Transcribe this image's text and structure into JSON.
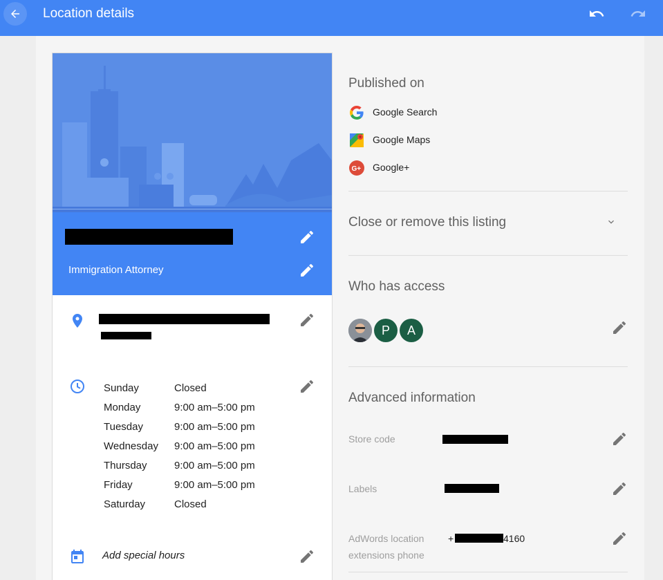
{
  "topbar": {
    "title": "Location details",
    "back_icon": "arrow-back-icon",
    "undo_icon": "undo-icon",
    "redo_icon": "redo-icon",
    "color": "#4285f4"
  },
  "business": {
    "category": "Immigration Attorney"
  },
  "hours": [
    {
      "day": "Sunday",
      "time": "Closed"
    },
    {
      "day": "Monday",
      "time": "9:00 am–5:00 pm"
    },
    {
      "day": "Tuesday",
      "time": "9:00 am–5:00 pm"
    },
    {
      "day": "Wednesday",
      "time": "9:00 am–5:00 pm"
    },
    {
      "day": "Thursday",
      "time": "9:00 am–5:00 pm"
    },
    {
      "day": "Friday",
      "time": "9:00 am–5:00 pm"
    },
    {
      "day": "Saturday",
      "time": "Closed"
    }
  ],
  "special_hours": "Add special hours",
  "published": {
    "title": "Published on",
    "items": [
      "Google Search",
      "Google Maps",
      "Google+"
    ]
  },
  "close_listing": "Close or remove this listing",
  "access": {
    "title": "Who has access",
    "avatars": [
      "P",
      "A"
    ]
  },
  "advanced": {
    "title": "Advanced information",
    "store_code_label": "Store code",
    "labels_label": "Labels",
    "phone_label_line1": "AdWords location",
    "phone_label_line2": "extensions phone",
    "phone_prefix": "+",
    "phone_suffix": "4160"
  }
}
